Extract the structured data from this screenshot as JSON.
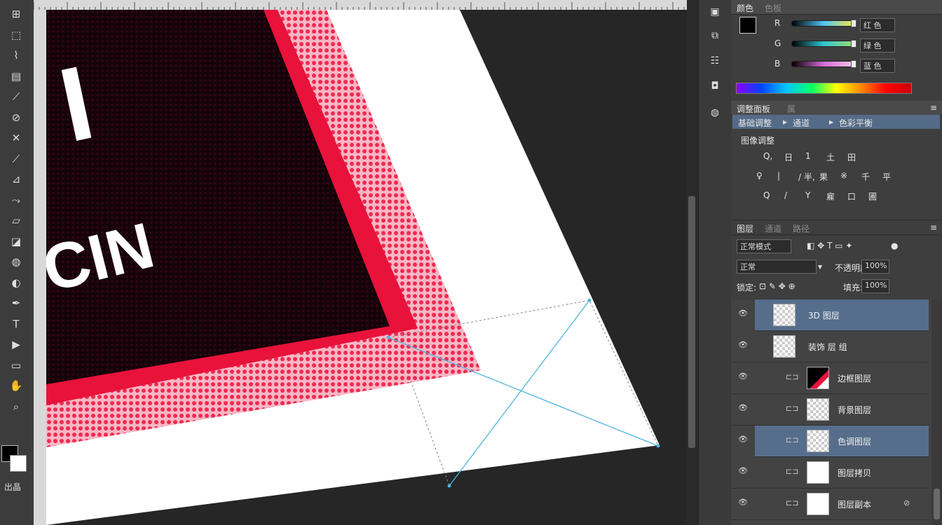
{
  "toolbar": {
    "tools": [
      "move-tool",
      "marquee-tool",
      "lasso-tool",
      "quick-selection-tool",
      "crop-tool",
      "eyedropper-tool",
      "healing-brush-tool",
      "brush-tool",
      "clone-stamp-tool",
      "history-brush-tool",
      "eraser-tool",
      "gradient-tool",
      "blur-tool",
      "dodge-tool",
      "pen-tool",
      "type-tool",
      "path-selection-tool",
      "shape-tool",
      "hand-tool",
      "zoom-tool"
    ],
    "glyphs": [
      "⊞",
      "⬚",
      "⌇",
      "▤",
      "⟋",
      "⊘",
      "✕",
      "⟋",
      "⊿",
      "⤳",
      "▱",
      "◪",
      "◍",
      "◐",
      "✒",
      "T",
      "▶",
      "▭",
      "✋",
      "⌕"
    ],
    "quickmask_label": "出晶"
  },
  "rulers": {
    "top_ticks": [
      "",
      "",
      "",
      "",
      "",
      "",
      "",
      "",
      "",
      "",
      "",
      "",
      "",
      "",
      "",
      "",
      "",
      ""
    ]
  },
  "artwork": {
    "text_top": "I",
    "text_mid": "CIN"
  },
  "color_panel": {
    "tabs": [
      "颜色",
      "色板"
    ],
    "rows": [
      {
        "label": "R",
        "value": "红 色"
      },
      {
        "label": "G",
        "value": "绿 色"
      },
      {
        "label": "B",
        "value": "蓝 色"
      }
    ]
  },
  "adjust_panel": {
    "tabs": [
      "调整面板",
      "属"
    ],
    "path": [
      "基础调整",
      "通道",
      "色彩平衡"
    ],
    "section": "图像调整",
    "row1": [
      "Q,",
      "日",
      "1",
      "土",
      "田"
    ],
    "row2": [
      "♀",
      "|",
      "/ 半,",
      "果",
      "※",
      "千",
      "平"
    ],
    "row3": [
      "Q",
      "/",
      "Y",
      "雇",
      "口",
      "圃"
    ]
  },
  "layers_panel": {
    "tabs": [
      "图层",
      "通道",
      "路径"
    ],
    "kind_label": "正常模式",
    "blend_mode": "正常",
    "opacity_label": "不透明度:",
    "opacity_value": "100%",
    "lock_label": "锁定:",
    "fill_label": "填充:",
    "fill_value": "100%",
    "layers": [
      {
        "name": "3D 图层",
        "thumb": "checker",
        "selected": true,
        "link": "",
        "fx": ""
      },
      {
        "name": "装饰 层 组",
        "thumb": "checker",
        "selected": false,
        "link": "",
        "fx": ""
      },
      {
        "name": "边框图层",
        "thumb": "red-frame",
        "selected": false,
        "link": "f",
        "fx": ""
      },
      {
        "name": "背景图层",
        "thumb": "checker",
        "selected": false,
        "link": "f",
        "fx": ""
      },
      {
        "name": "色调图层",
        "thumb": "checker",
        "selected": true,
        "link": "f",
        "fx": ""
      },
      {
        "name": "图层拷贝",
        "thumb": "white",
        "selected": false,
        "link": "f",
        "fx": ""
      },
      {
        "name": "图层副本",
        "thumb": "white",
        "selected": false,
        "link": "f",
        "fx": "⊘"
      }
    ]
  },
  "colors": {
    "accent_red": "#e8123a",
    "selection_blue": "#4a6a8c",
    "guide_cyan": "#4fb4e0"
  }
}
